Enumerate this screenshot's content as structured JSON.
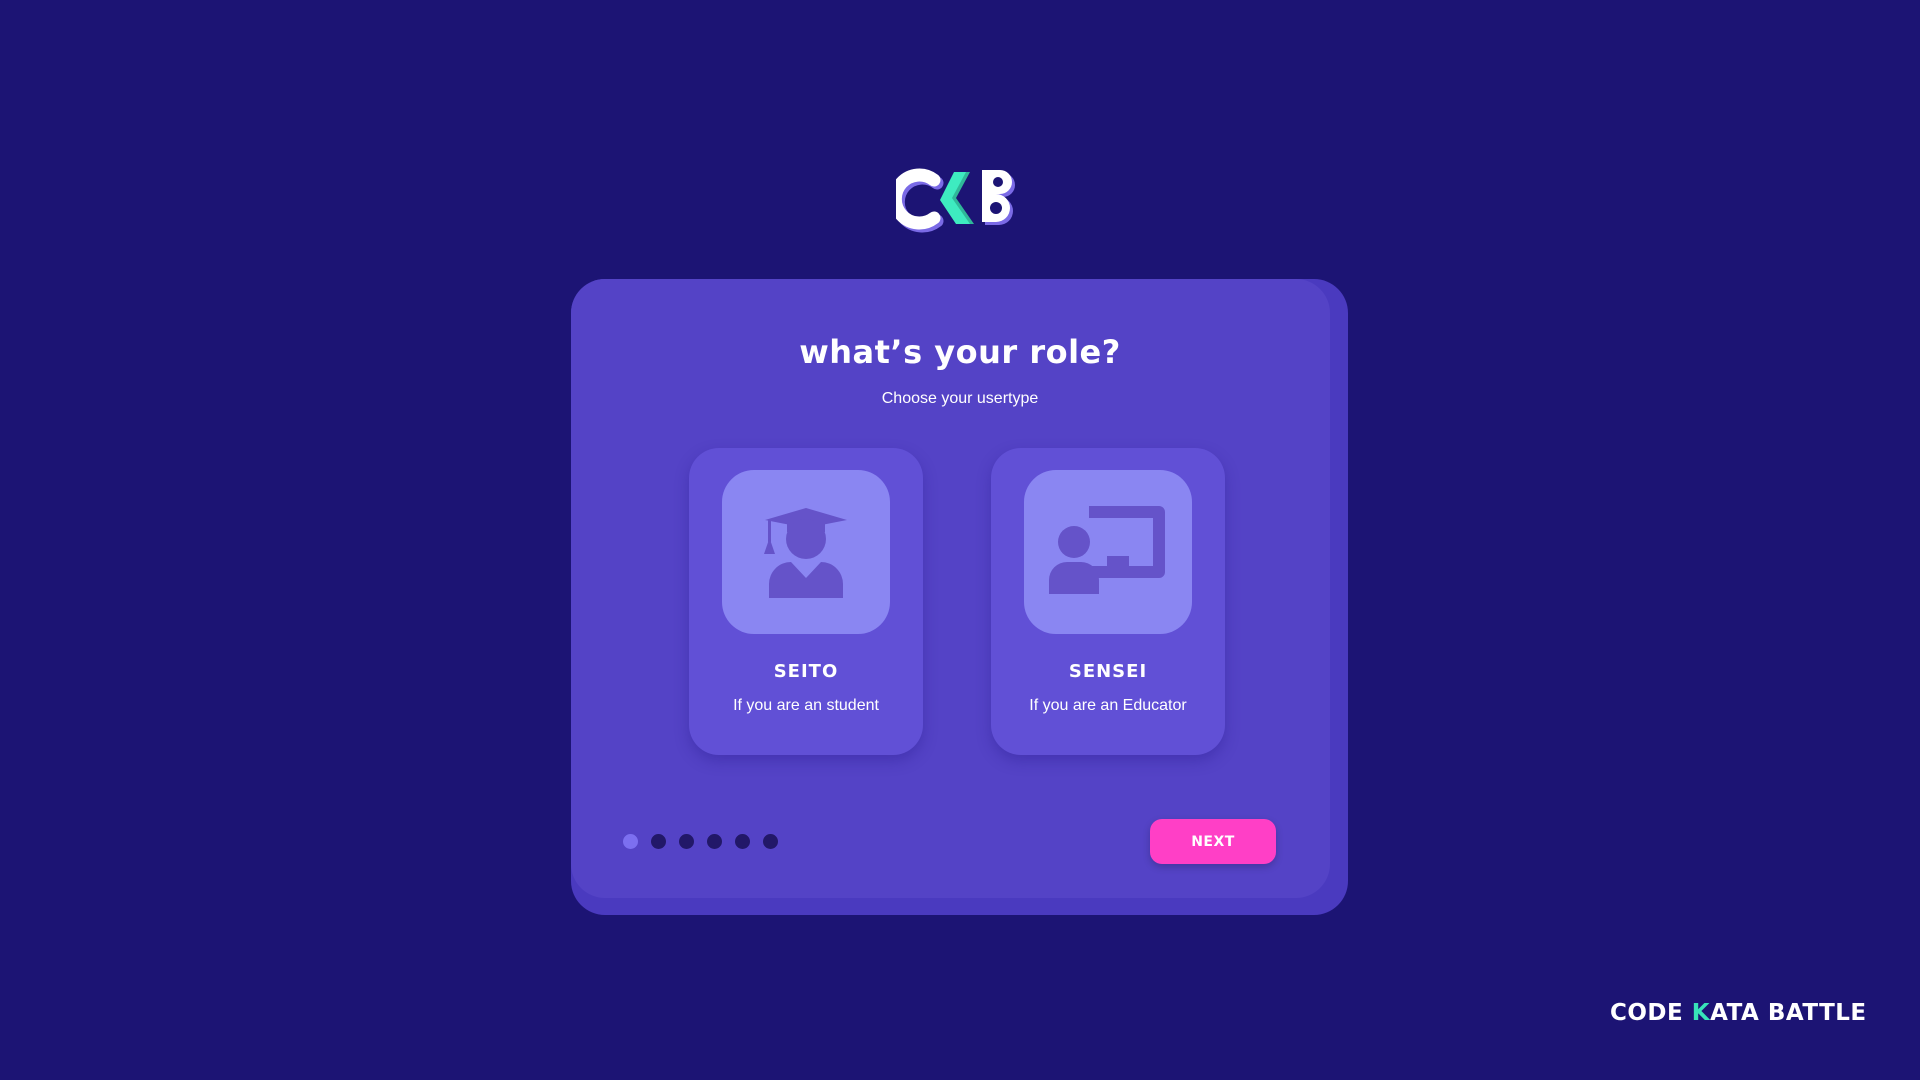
{
  "logo": {
    "text": "CKB"
  },
  "dialog": {
    "title": "what’s your role?",
    "subtitle": "Choose your usertype"
  },
  "roles": [
    {
      "name": "SEITO",
      "description": "If you are an student",
      "icon": "graduate-student-icon"
    },
    {
      "name": "SENSEI",
      "description": "If you are an Educator",
      "icon": "teacher-board-icon"
    }
  ],
  "pagination": {
    "total_steps": 6,
    "current_step": 1
  },
  "next_button": {
    "label": "NEXT"
  },
  "brand": {
    "part1": "CODE",
    "part2": "K",
    "part3": "ATA BATTLE"
  },
  "colors": {
    "background": "#1c1474",
    "card": "#5443c6",
    "role_card": "#6150d6",
    "icon_box": "#8a86f2",
    "accent_pink": "#ff3fc6",
    "accent_teal": "#38e3b9"
  }
}
